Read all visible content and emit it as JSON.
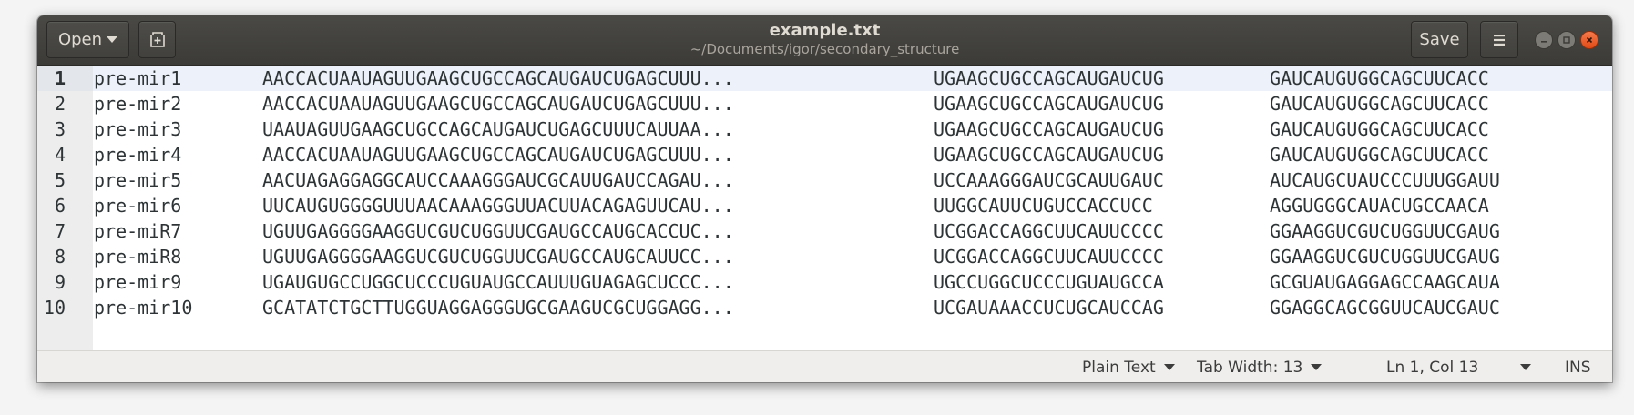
{
  "header": {
    "open_label": "Open",
    "title": "example.txt",
    "subtitle": "~/Documents/igor/secondary_structure",
    "save_label": "Save"
  },
  "editor": {
    "lines": [
      {
        "num": "1",
        "c1": "pre-mir1",
        "c2": "AACCACUAAUAGUUGAAGCUGCCAGCAUGAUCUGAGCUUU...",
        "c3": "UGAAGCUGCCAGCAUGAUCUG",
        "c4": "GAUCAUGUGGCAGCUUCACC"
      },
      {
        "num": "2",
        "c1": "pre-mir2",
        "c2": "AACCACUAAUAGUUGAAGCUGCCAGCAUGAUCUGAGCUUU...",
        "c3": "UGAAGCUGCCAGCAUGAUCUG",
        "c4": "GAUCAUGUGGCAGCUUCACC"
      },
      {
        "num": "3",
        "c1": "pre-mir3",
        "c2": "UAAUAGUUGAAGCUGCCAGCAUGAUCUGAGCUUUCAUUAA...",
        "c3": "UGAAGCUGCCAGCAUGAUCUG",
        "c4": "GAUCAUGUGGCAGCUUCACC"
      },
      {
        "num": "4",
        "c1": "pre-mir4",
        "c2": "AACCACUAAUAGUUGAAGCUGCCAGCAUGAUCUGAGCUUU...",
        "c3": "UGAAGCUGCCAGCAUGAUCUG",
        "c4": "GAUCAUGUGGCAGCUUCACC"
      },
      {
        "num": "5",
        "c1": "pre-mir5",
        "c2": "AACUAGAGGAGGCAUCCAAAGGGAUCGCAUUGAUCCAGAU...",
        "c3": "UCCAAAGGGAUCGCAUUGAUC",
        "c4": "AUCAUGCUAUCCCUUUGGAUU"
      },
      {
        "num": "6",
        "c1": "pre-mir6",
        "c2": "UUCAUGUGGGGUUUAACAAAGGGUUACUUACAGAGUUCAU...",
        "c3": "UUGGCAUUCUGUCCACCUCC",
        "c4": "AGGUGGGCAUACUGCCAACA"
      },
      {
        "num": "7",
        "c1": "pre-miR7",
        "c2": "UGUUGAGGGGAAGGUCGUCUGGUUCGAUGCCAUGCACCUC...",
        "c3": "UCGGACCAGGCUUCAUUCCCC",
        "c4": "GGAAGGUCGUCUGGUUCGAUG"
      },
      {
        "num": "8",
        "c1": "pre-miR8",
        "c2": "UGUUGAGGGGAAGGUCGUCUGGUUCGAUGCCAUGCAUUCC...",
        "c3": "UCGGACCAGGCUUCAUUCCCC",
        "c4": "GGAAGGUCGUCUGGUUCGAUG"
      },
      {
        "num": "9",
        "c1": "pre-mir9",
        "c2": "UGAUGUGCCUGGCUCCCUGUAUGCCAUUUGUAGAGCUCCC...",
        "c3": "UGCCUGGCUCCCUGUAUGCCA",
        "c4": "GCGUAUGAGGAGCCAAGCAUA"
      },
      {
        "num": "10",
        "c1": "pre-mir10",
        "c2": "GCATATCTGCTTUGGUAGGAGGGUGCGAAGUCGCUGGAGG...",
        "c3": "UCGAUAAACCUCUGCAUCCAG",
        "c4": "GGAGGCAGCGGUUCAUCGAUC"
      }
    ]
  },
  "statusbar": {
    "language": "Plain Text",
    "tab_width": "Tab Width: 13",
    "position": "Ln 1, Col 13",
    "mode": "INS"
  }
}
